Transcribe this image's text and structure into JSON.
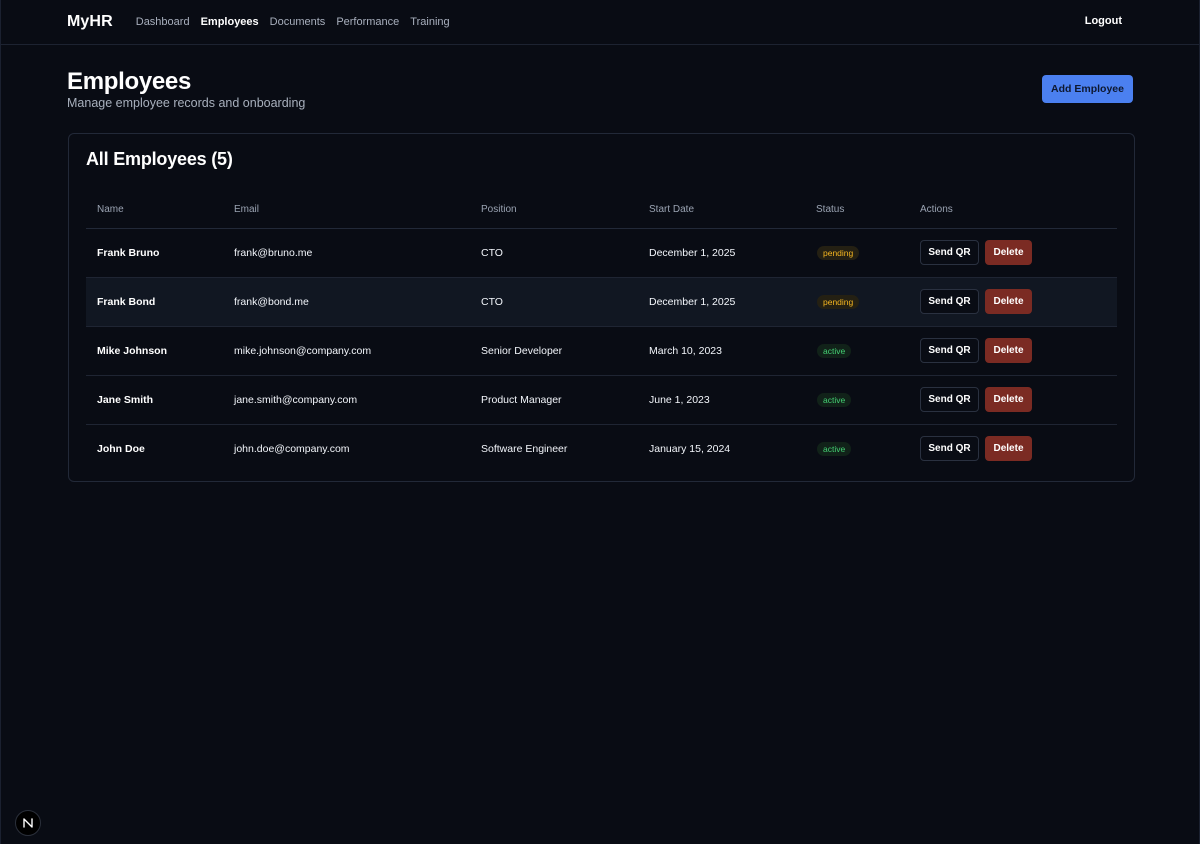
{
  "nav": {
    "brand": "MyHR",
    "links": [
      "Dashboard",
      "Employees",
      "Documents",
      "Performance",
      "Training"
    ],
    "active": "Employees",
    "logout": "Logout"
  },
  "page": {
    "title": "Employees",
    "subtitle": "Manage employee records and onboarding",
    "add_button": "Add Employee"
  },
  "card": {
    "title": "All Employees (5)"
  },
  "table": {
    "headers": [
      "Name",
      "Email",
      "Position",
      "Start Date",
      "Status",
      "Actions"
    ],
    "rows": [
      {
        "name": "Frank Bruno",
        "email": "frank@bruno.me",
        "position": "CTO",
        "start_date": "December 1, 2025",
        "status": "pending"
      },
      {
        "name": "Frank Bond",
        "email": "frank@bond.me",
        "position": "CTO",
        "start_date": "December 1, 2025",
        "status": "pending"
      },
      {
        "name": "Mike Johnson",
        "email": "mike.johnson@company.com",
        "position": "Senior Developer",
        "start_date": "March 10, 2023",
        "status": "active"
      },
      {
        "name": "Jane Smith",
        "email": "jane.smith@company.com",
        "position": "Product Manager",
        "start_date": "June 1, 2023",
        "status": "active"
      },
      {
        "name": "John Doe",
        "email": "john.doe@company.com",
        "position": "Software Engineer",
        "start_date": "January 15, 2024",
        "status": "active"
      }
    ],
    "action_labels": {
      "send": "Send QR",
      "delete": "Delete"
    }
  },
  "colors": {
    "accent": "#4b80f0",
    "delete": "#7b2b23",
    "pending": "#f4b520",
    "active": "#44d073",
    "background": "#090c14"
  },
  "icons": {
    "dev_indicator": "next-logo-icon"
  }
}
